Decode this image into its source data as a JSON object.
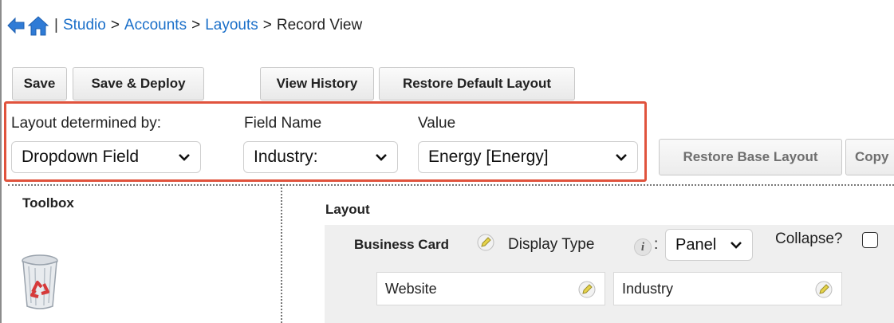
{
  "breadcrumb": {
    "separator": "|",
    "items": [
      "Studio",
      "Accounts",
      "Layouts"
    ],
    "current": "Record View",
    "arrow": ">"
  },
  "toolbar": {
    "save": "Save",
    "save_deploy": "Save & Deploy",
    "view_history": "View History",
    "restore_default": "Restore Default Layout"
  },
  "layout_selector": {
    "determined_by_label": "Layout determined by:",
    "field_name_label": "Field Name",
    "value_label": "Value",
    "determined_by_value": "Dropdown Field",
    "field_name_value": "Industry:",
    "value_value": "Energy [Energy]",
    "highlight_color": "#e0533d"
  },
  "actions": {
    "restore_base": "Restore Base Layout",
    "copy": "Copy"
  },
  "toolbox": {
    "title": "Toolbox"
  },
  "layout": {
    "title": "Layout",
    "panel_name": "Business Card",
    "display_type_label": "Display Type",
    "info_glyph": "i",
    "colon": ":",
    "display_type_value": "Panel",
    "collapse_label": "Collapse?",
    "fields": [
      "Website",
      "Industry"
    ]
  },
  "colors": {
    "link": "#1a6fc9"
  }
}
